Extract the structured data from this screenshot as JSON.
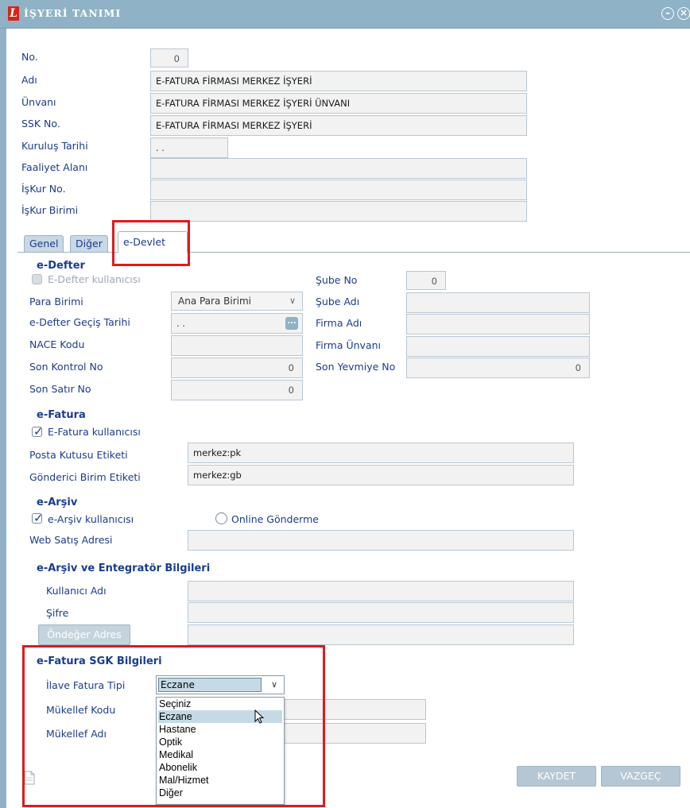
{
  "window": {
    "title": "İŞYERİ TANIMI",
    "logo": "L",
    "minimize_icon": "⊖",
    "close_icon": "⊗"
  },
  "form": {
    "no_label": "No.",
    "no_value": "0",
    "adi_label": "Adı",
    "adi_value": "E-FATURA FİRMASI MERKEZ İŞYERİ",
    "unvan_label": "Ünvanı",
    "unvan_value": "E-FATURA FİRMASI MERKEZ İŞYERİ ÜNVANI",
    "ssk_label": "SSK No.",
    "ssk_value": "E-FATURA FİRMASI MERKEZ İŞYERİ",
    "kurulus_label": "Kuruluş Tarihi",
    "kurulus_value": ". .",
    "faaliyet_label": "Faaliyet Alanı",
    "faaliyet_value": "",
    "iskur_no_label": "İşKur No.",
    "iskur_no_value": "",
    "iskur_birimi_label": "İşKur Birimi",
    "iskur_birimi_value": ""
  },
  "tabs": {
    "genel": "Genel",
    "diger": "Diğer",
    "edevlet": "e-Devlet"
  },
  "edefter": {
    "title": "e-Defter",
    "kullanici_label": "E-Defter kullanıcısı",
    "para_birimi_label": "Para Birimi",
    "para_birimi_value": "Ana Para Birimi",
    "gecis_label": "e-Defter Geçiş Tarihi",
    "gecis_value": ". .",
    "ellipsis": "...",
    "nace_label": "NACE Kodu",
    "son_kontrol_label": "Son Kontrol No",
    "son_kontrol_value": "0",
    "son_satir_label": "Son Satır No",
    "son_satir_value": "0",
    "sube_no_label": "Şube No",
    "sube_no_value": "0",
    "sube_adi_label": "Şube Adı",
    "firma_adi_label": "Firma Adı",
    "firma_unvani_label": "Firma Ünvanı",
    "son_yevmiye_label": "Son Yevmiye No",
    "son_yevmiye_value": "0"
  },
  "efatura": {
    "title": "e-Fatura",
    "kullanici_label": "E-Fatura kullanıcısı",
    "posta_label": "Posta Kutusu Etiketi",
    "posta_value": "merkez:pk",
    "gonderici_label": "Gönderici Birim Etiketi",
    "gonderici_value": "merkez:gb"
  },
  "earsiv": {
    "title": "e-Arşiv",
    "kullanici_label": "e-Arşiv kullanıcısı",
    "online_label": "Online Gönderme",
    "web_label": "Web Satış Adresi"
  },
  "entegrator": {
    "title": "e-Arşiv ve Entegratör Bilgileri",
    "kullanici_adi_label": "Kullanıcı Adı",
    "sifre_label": "Şifre",
    "ondeger_button": "Öndeğer Adres"
  },
  "sgk": {
    "title": "e-Fatura SGK Bilgileri",
    "ilave_label": "İlave Fatura Tipi",
    "ilave_value": "Eczane",
    "mukellef_kodu_label": "Mükellef Kodu",
    "mukellef_adi_label": "Mükellef Adı",
    "options": [
      "Seçiniz",
      "Eczane",
      "Hastane",
      "Optik",
      "Medikal",
      "Abonelik",
      "Mal/Hizmet",
      "Diğer"
    ]
  },
  "buttons": {
    "kaydet": "KAYDET",
    "vazgec": "VAZGEÇ"
  }
}
